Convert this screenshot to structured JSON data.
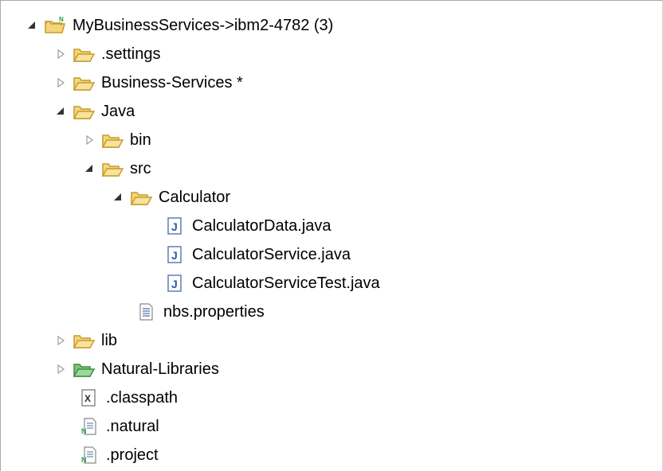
{
  "tree": {
    "nodes": [
      {
        "id": "root",
        "label": "MyBusinessServices->ibm2-4782 (3)",
        "level": 0,
        "state": "expanded",
        "icon": "project-folder-icon"
      },
      {
        "id": "settings",
        "label": ".settings",
        "level": 1,
        "state": "collapsed",
        "icon": "folder-icon"
      },
      {
        "id": "business-services",
        "label": "Business-Services *",
        "level": 1,
        "state": "collapsed",
        "icon": "folder-icon"
      },
      {
        "id": "java",
        "label": "Java",
        "level": 1,
        "state": "expanded",
        "icon": "folder-icon"
      },
      {
        "id": "bin",
        "label": "bin",
        "level": 2,
        "state": "collapsed",
        "icon": "folder-icon"
      },
      {
        "id": "src",
        "label": "src",
        "level": 2,
        "state": "expanded",
        "icon": "folder-icon"
      },
      {
        "id": "calculator",
        "label": "Calculator",
        "level": 3,
        "state": "expanded",
        "icon": "folder-icon"
      },
      {
        "id": "calculator-data",
        "label": "CalculatorData.java",
        "level": 4,
        "state": "leaf",
        "icon": "java-file-icon"
      },
      {
        "id": "calculator-service",
        "label": "CalculatorService.java",
        "level": 4,
        "state": "leaf",
        "icon": "java-file-icon"
      },
      {
        "id": "calculator-service-test",
        "label": "CalculatorServiceTest.java",
        "level": 4,
        "state": "leaf",
        "icon": "java-file-icon"
      },
      {
        "id": "nbs-properties",
        "label": "nbs.properties",
        "level": 3,
        "state": "leaf",
        "icon": "text-file-icon"
      },
      {
        "id": "lib",
        "label": "lib",
        "level": 1,
        "state": "collapsed",
        "icon": "folder-icon"
      },
      {
        "id": "natural-libraries",
        "label": "Natural-Libraries",
        "level": 1,
        "state": "collapsed",
        "icon": "natural-library-folder-icon"
      },
      {
        "id": "classpath",
        "label": ".classpath",
        "level": 1,
        "state": "leaf",
        "icon": "xml-file-icon"
      },
      {
        "id": "natural",
        "label": ".natural",
        "level": 1,
        "state": "leaf",
        "icon": "natural-file-icon"
      },
      {
        "id": "project",
        "label": ".project",
        "level": 1,
        "state": "leaf",
        "icon": "natural-file-icon"
      }
    ]
  },
  "colors": {
    "folder_fill": "#f3d67b",
    "folder_stroke": "#c89a2c",
    "natural_folder_fill": "#7cc37c",
    "natural_folder_stroke": "#3f8f3f",
    "java_icon_blue": "#2f58a8",
    "expander_arrow": "#333333",
    "collapsed_arrow": "#9c9c9c"
  }
}
